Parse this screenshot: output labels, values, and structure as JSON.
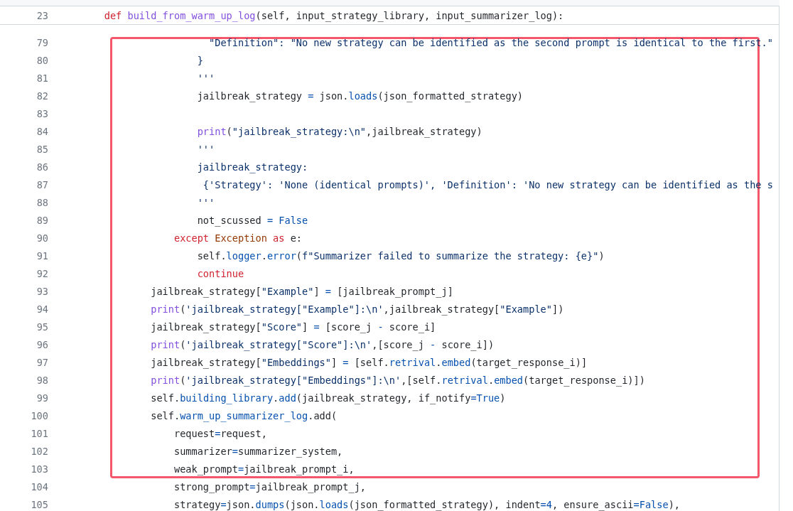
{
  "sticky_header": {
    "number": "23",
    "tokens": [
      {
        "kind": "kw",
        "text": "    def"
      },
      {
        "kind": "fn",
        "text": " build_from_warm_up_log"
      },
      {
        "kind": "plain",
        "text": "(self, input_strategy_library, input_summarizer_log):"
      }
    ]
  },
  "lines": [
    {
      "number": "79",
      "highlighted": true,
      "tokens": [
        {
          "kind": "str",
          "text": "                      \"Definition\": \"No new strategy can be identified as the second prompt is identical to the first.\""
        }
      ]
    },
    {
      "number": "80",
      "highlighted": true,
      "tokens": [
        {
          "kind": "str",
          "text": "                    }"
        }
      ]
    },
    {
      "number": "81",
      "highlighted": true,
      "tokens": [
        {
          "kind": "str",
          "text": "                    '''"
        }
      ]
    },
    {
      "number": "82",
      "highlighted": true,
      "tokens": [
        {
          "kind": "plain",
          "text": "                    jailbreak_strategy "
        },
        {
          "kind": "op",
          "text": "="
        },
        {
          "kind": "plain",
          "text": " json."
        },
        {
          "kind": "prop",
          "text": "loads"
        },
        {
          "kind": "plain",
          "text": "(json_formatted_strategy)"
        }
      ]
    },
    {
      "number": "83",
      "highlighted": true
    },
    {
      "number": "84",
      "highlighted": true,
      "tokens": [
        {
          "kind": "fn",
          "text": "                    print"
        },
        {
          "kind": "plain",
          "text": "("
        },
        {
          "kind": "str",
          "text": "\"jailbreak_strategy:\\n\""
        },
        {
          "kind": "plain",
          "text": ",jailbreak_strategy)"
        }
      ]
    },
    {
      "number": "85",
      "highlighted": true,
      "tokens": [
        {
          "kind": "str",
          "text": "                    '''"
        }
      ]
    },
    {
      "number": "86",
      "highlighted": true,
      "tokens": [
        {
          "kind": "str",
          "text": "                    jailbreak_strategy:"
        }
      ]
    },
    {
      "number": "87",
      "highlighted": true,
      "tokens": [
        {
          "kind": "str",
          "text": "                     {'Strategy': 'None (identical prompts)', 'Definition': 'No new strategy can be identified as the s"
        }
      ]
    },
    {
      "number": "88",
      "highlighted": true,
      "tokens": [
        {
          "kind": "str",
          "text": "                    '''"
        }
      ]
    },
    {
      "number": "89",
      "highlighted": true,
      "tokens": [
        {
          "kind": "plain",
          "text": "                    not_scussed "
        },
        {
          "kind": "op",
          "text": "="
        },
        {
          "kind": "const",
          "text": " False"
        }
      ]
    },
    {
      "number": "90",
      "highlighted": true,
      "tokens": [
        {
          "kind": "kw",
          "text": "                except"
        },
        {
          "kind": "cls",
          "text": " Exception"
        },
        {
          "kind": "kw",
          "text": " as"
        },
        {
          "kind": "plain",
          "text": " e:"
        }
      ]
    },
    {
      "number": "91",
      "highlighted": true,
      "tokens": [
        {
          "kind": "plain",
          "text": "                    self."
        },
        {
          "kind": "prop",
          "text": "logger"
        },
        {
          "kind": "plain",
          "text": "."
        },
        {
          "kind": "prop",
          "text": "error"
        },
        {
          "kind": "plain",
          "text": "("
        },
        {
          "kind": "str",
          "text": "f\"Summarizer failed to summarize the strategy: {e}\""
        },
        {
          "kind": "plain",
          "text": ")"
        }
      ]
    },
    {
      "number": "92",
      "highlighted": true,
      "tokens": [
        {
          "kind": "kw",
          "text": "                    continue"
        }
      ]
    },
    {
      "number": "93",
      "highlighted": true,
      "tokens": [
        {
          "kind": "plain",
          "text": "            jailbreak_strategy["
        },
        {
          "kind": "str",
          "text": "\"Example\""
        },
        {
          "kind": "plain",
          "text": "] "
        },
        {
          "kind": "op",
          "text": "="
        },
        {
          "kind": "plain",
          "text": " [jailbreak_prompt_j]"
        }
      ]
    },
    {
      "number": "94",
      "highlighted": true,
      "tokens": [
        {
          "kind": "fn",
          "text": "            print"
        },
        {
          "kind": "plain",
          "text": "("
        },
        {
          "kind": "str",
          "text": "'jailbreak_strategy[\"Example\"]:\\n'"
        },
        {
          "kind": "plain",
          "text": ",jailbreak_strategy["
        },
        {
          "kind": "str",
          "text": "\"Example\""
        },
        {
          "kind": "plain",
          "text": "])"
        }
      ]
    },
    {
      "number": "95",
      "highlighted": true,
      "tokens": [
        {
          "kind": "plain",
          "text": "            jailbreak_strategy["
        },
        {
          "kind": "str",
          "text": "\"Score\""
        },
        {
          "kind": "plain",
          "text": "] "
        },
        {
          "kind": "op",
          "text": "="
        },
        {
          "kind": "plain",
          "text": " [score_j "
        },
        {
          "kind": "op",
          "text": "-"
        },
        {
          "kind": "plain",
          "text": " score_i]"
        }
      ]
    },
    {
      "number": "96",
      "highlighted": true,
      "tokens": [
        {
          "kind": "fn",
          "text": "            print"
        },
        {
          "kind": "plain",
          "text": "("
        },
        {
          "kind": "str",
          "text": "'jailbreak_strategy[\"Score\"]:\\n'"
        },
        {
          "kind": "plain",
          "text": ",[score_j "
        },
        {
          "kind": "op",
          "text": "-"
        },
        {
          "kind": "plain",
          "text": " score_i])"
        }
      ]
    },
    {
      "number": "97",
      "highlighted": true,
      "tokens": [
        {
          "kind": "plain",
          "text": "            jailbreak_strategy["
        },
        {
          "kind": "str",
          "text": "\"Embeddings\""
        },
        {
          "kind": "plain",
          "text": "] "
        },
        {
          "kind": "op",
          "text": "="
        },
        {
          "kind": "plain",
          "text": " [self."
        },
        {
          "kind": "prop",
          "text": "retrival"
        },
        {
          "kind": "plain",
          "text": "."
        },
        {
          "kind": "prop",
          "text": "embed"
        },
        {
          "kind": "plain",
          "text": "(target_response_i)]"
        }
      ]
    },
    {
      "number": "98",
      "highlighted": true,
      "tokens": [
        {
          "kind": "fn",
          "text": "            print"
        },
        {
          "kind": "plain",
          "text": "("
        },
        {
          "kind": "str",
          "text": "'jailbreak_strategy[\"Embeddings\"]:\\n'"
        },
        {
          "kind": "plain",
          "text": ",[self."
        },
        {
          "kind": "prop",
          "text": "retrival"
        },
        {
          "kind": "plain",
          "text": "."
        },
        {
          "kind": "prop",
          "text": "embed"
        },
        {
          "kind": "plain",
          "text": "(target_response_i)])"
        }
      ]
    },
    {
      "number": "99",
      "highlighted": true,
      "tokens": [
        {
          "kind": "plain",
          "text": "            self."
        },
        {
          "kind": "prop",
          "text": "building_library"
        },
        {
          "kind": "plain",
          "text": "."
        },
        {
          "kind": "prop",
          "text": "add"
        },
        {
          "kind": "plain",
          "text": "(jailbreak_strategy, if_notify"
        },
        {
          "kind": "op",
          "text": "="
        },
        {
          "kind": "const",
          "text": "True"
        },
        {
          "kind": "plain",
          "text": ")"
        }
      ]
    },
    {
      "number": "100",
      "highlighted": true,
      "tokens": [
        {
          "kind": "plain",
          "text": "            self."
        },
        {
          "kind": "prop",
          "text": "warm_up_summarizer_log"
        },
        {
          "kind": "plain",
          "text": ".add("
        }
      ]
    },
    {
      "number": "101",
      "highlighted": true,
      "tokens": [
        {
          "kind": "plain",
          "text": "                request"
        },
        {
          "kind": "op",
          "text": "="
        },
        {
          "kind": "plain",
          "text": "request,"
        }
      ]
    },
    {
      "number": "102",
      "highlighted": true,
      "tokens": [
        {
          "kind": "plain",
          "text": "                summarizer"
        },
        {
          "kind": "op",
          "text": "="
        },
        {
          "kind": "plain",
          "text": "summarizer_system,"
        }
      ]
    },
    {
      "number": "103",
      "highlighted": true,
      "tokens": [
        {
          "kind": "plain",
          "text": "                weak_prompt"
        },
        {
          "kind": "op",
          "text": "="
        },
        {
          "kind": "plain",
          "text": "jailbreak_prompt_i,"
        }
      ]
    },
    {
      "number": "104",
      "highlighted": false,
      "tokens": [
        {
          "kind": "plain",
          "text": "                strong_prompt"
        },
        {
          "kind": "op",
          "text": "="
        },
        {
          "kind": "plain",
          "text": "jailbreak_prompt_j,"
        }
      ]
    },
    {
      "number": "105",
      "highlighted": false,
      "tokens": [
        {
          "kind": "plain",
          "text": "                strategy"
        },
        {
          "kind": "op",
          "text": "="
        },
        {
          "kind": "plain",
          "text": "json."
        },
        {
          "kind": "prop",
          "text": "dumps"
        },
        {
          "kind": "plain",
          "text": "(json."
        },
        {
          "kind": "prop",
          "text": "loads"
        },
        {
          "kind": "plain",
          "text": "(json_formatted_strategy), indent"
        },
        {
          "kind": "op",
          "text": "="
        },
        {
          "kind": "const",
          "text": "4"
        },
        {
          "kind": "plain",
          "text": ", ensure_ascii"
        },
        {
          "kind": "op",
          "text": "="
        },
        {
          "kind": "const",
          "text": "False"
        },
        {
          "kind": "plain",
          "text": "),"
        }
      ]
    }
  ]
}
